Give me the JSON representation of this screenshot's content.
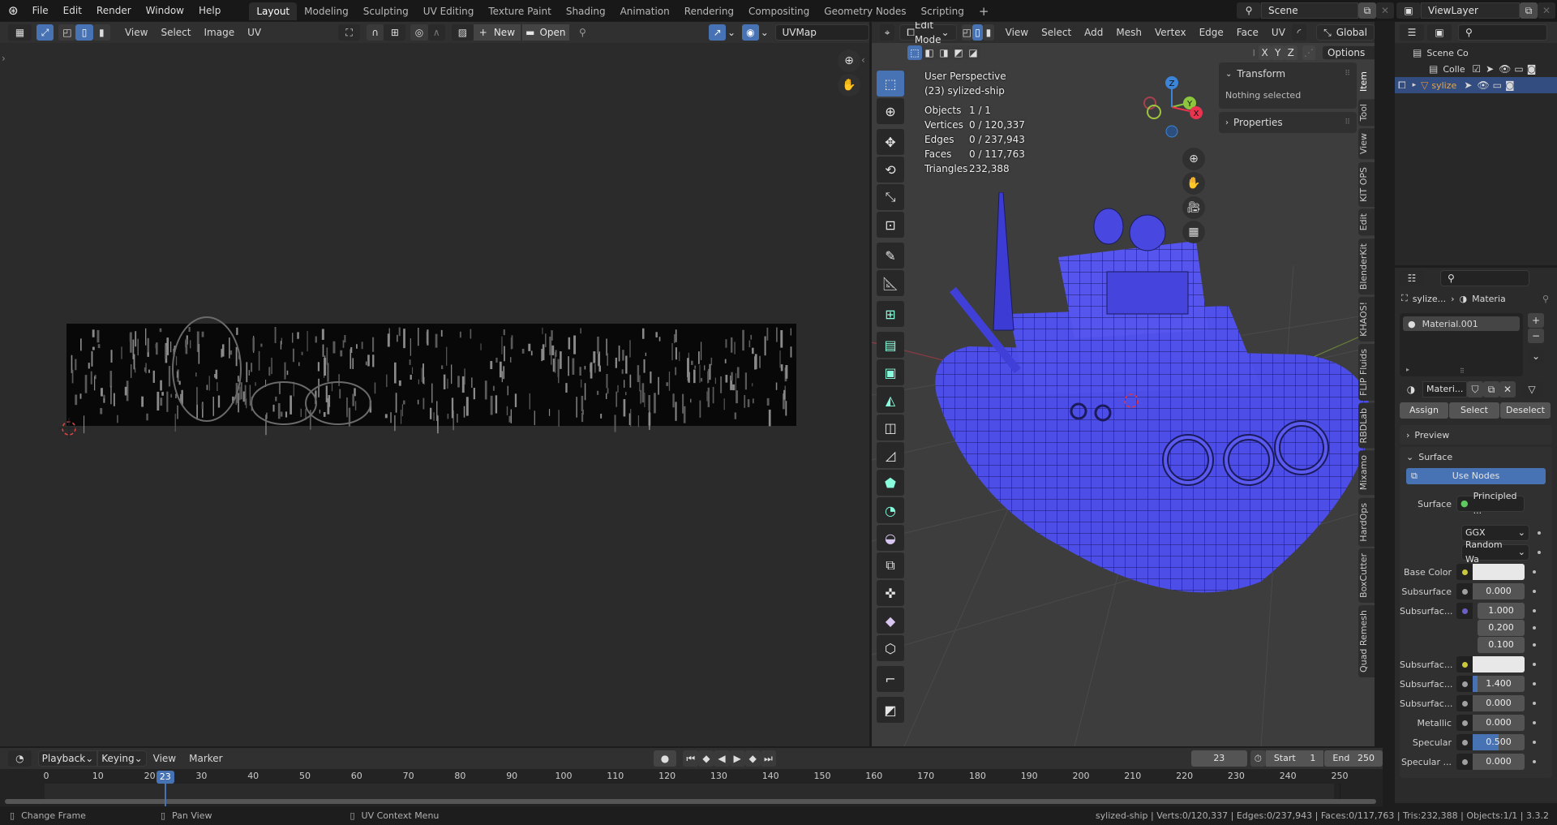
{
  "top_menu": {
    "items": [
      "File",
      "Edit",
      "Render",
      "Window",
      "Help"
    ],
    "workspaces": [
      "Layout",
      "Modeling",
      "Sculpting",
      "UV Editing",
      "Texture Paint",
      "Shading",
      "Animation",
      "Rendering",
      "Compositing",
      "Geometry Nodes",
      "Scripting"
    ],
    "active_workspace": "Layout",
    "add_tab": "+",
    "scene": "Scene",
    "view_layer": "ViewLayer"
  },
  "uv_editor": {
    "menus": [
      "View",
      "Select",
      "Image",
      "UV"
    ],
    "new_label": "New",
    "open_label": "Open",
    "uvmap": "UVMap"
  },
  "viewport": {
    "mode": "Edit Mode",
    "menus": [
      "View",
      "Select",
      "Add",
      "Mesh",
      "Vertex",
      "Edge",
      "Face",
      "UV"
    ],
    "orientation": "Global",
    "axes": [
      "X",
      "Y",
      "Z"
    ],
    "options_label": "Options",
    "overlay_title": "User Perspective",
    "overlay_object": "(23) sylized-ship",
    "stats": [
      {
        "label": "Objects",
        "value": "1 / 1"
      },
      {
        "label": "Vertices",
        "value": "0 / 120,337"
      },
      {
        "label": "Edges",
        "value": "0 / 237,943"
      },
      {
        "label": "Faces",
        "value": "0 / 117,763"
      },
      {
        "label": "Triangles",
        "value": "232,388"
      }
    ],
    "gizmo_axes": {
      "x": "X",
      "y": "Y",
      "z": "Z"
    },
    "colors": {
      "mesh": "#4a4ae8",
      "x": "#e8344e",
      "y": "#8cc63f",
      "z": "#3b84d8",
      "select": "#4772b3"
    }
  },
  "n_panel": {
    "transform_label": "Transform",
    "nothing_selected": "Nothing selected",
    "properties_label": "Properties",
    "tabs": [
      "Item",
      "Tool",
      "View",
      "KIT OPS",
      "Edit",
      "BlenderKit",
      "KHAOS!",
      "FLIP Fluids",
      "RBDLab",
      "Mixamo",
      "HardOps",
      "BoxCutter",
      "Quad Remesh"
    ]
  },
  "outliner": {
    "scene_collection": "Scene Co",
    "collection": "Colle",
    "object": "sylize"
  },
  "properties": {
    "breadcrumb_object": "sylize...",
    "breadcrumb_tab": "Materia",
    "material_slot": "Material.001",
    "material_name": "Materi...",
    "assign": "Assign",
    "select": "Select",
    "deselect": "Deselect",
    "preview_label": "Preview",
    "surface_label": "Surface",
    "use_nodes": "Use Nodes",
    "surface_shader_label": "Surface",
    "surface_shader": "Principled ...",
    "distribution": "GGX",
    "subsurface_method": "Random Wa",
    "rows": [
      {
        "label": "Base Color",
        "socket": "#c8c83a",
        "type": "color",
        "value": ""
      },
      {
        "label": "Subsurface",
        "socket": "#a0a0a0",
        "type": "num",
        "value": "0.000",
        "fill": 0
      },
      {
        "label": "Subsurfac...",
        "socket": "#6b5fc8",
        "type": "vec",
        "values": [
          "1.000",
          "0.200",
          "0.100"
        ]
      },
      {
        "label": "Subsurfac...",
        "socket": "#c8c83a",
        "type": "color",
        "value": ""
      },
      {
        "label": "Subsurfac...",
        "socket": "#a0a0a0",
        "type": "num",
        "value": "1.400",
        "fill": 0.1
      },
      {
        "label": "Subsurfac...",
        "socket": "#a0a0a0",
        "type": "num",
        "value": "0.000",
        "fill": 0
      },
      {
        "label": "Metallic",
        "socket": "#a0a0a0",
        "type": "num",
        "value": "0.000",
        "fill": 0
      },
      {
        "label": "Specular",
        "socket": "#a0a0a0",
        "type": "num",
        "value": "0.500",
        "fill": 0.5
      },
      {
        "label": "Specular ...",
        "socket": "#a0a0a0",
        "type": "num",
        "value": "0.000",
        "fill": 0
      }
    ]
  },
  "timeline": {
    "menus": [
      "Playback",
      "Keying",
      "View",
      "Marker"
    ],
    "current_frame": "23",
    "start_label": "Start",
    "start": "1",
    "end_label": "End",
    "end": "250",
    "ticks": [
      "0",
      "10",
      "20",
      "30",
      "40",
      "50",
      "60",
      "70",
      "80",
      "90",
      "100",
      "110",
      "120",
      "130",
      "140",
      "150",
      "160",
      "170",
      "180",
      "190",
      "200",
      "210",
      "220",
      "230",
      "240",
      "250"
    ],
    "frame_value": 23
  },
  "status_bar": {
    "hints": [
      "Change Frame",
      "Pan View",
      "UV Context Menu"
    ],
    "info": "sylized-ship | Verts:0/120,337 | Edges:0/237,943 | Faces:0/117,763 | Tris:232,388 | Objects:1/1 | 3.3.2"
  }
}
